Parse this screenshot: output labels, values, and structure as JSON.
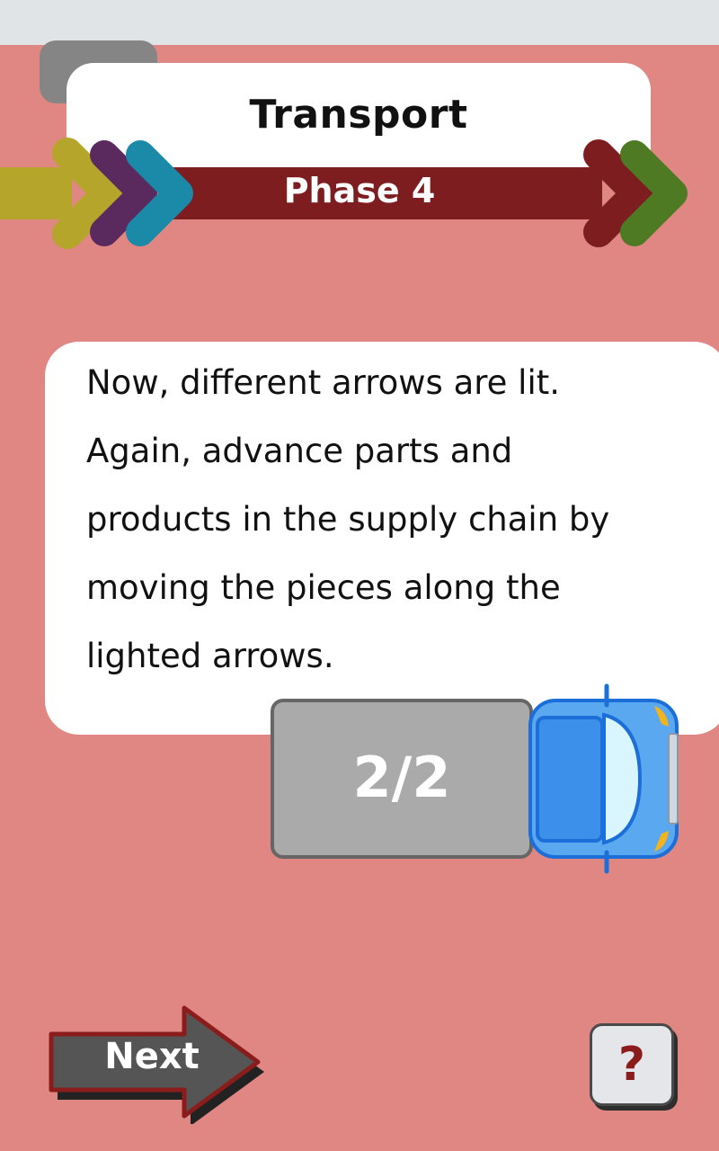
{
  "header": {
    "title": "Transport",
    "phase_label": "Phase 4"
  },
  "instruction": {
    "lines": [
      "Now, different arrows are lit.",
      "Again, advance parts and",
      "products in the supply chain by",
      "moving the pieces along the",
      "lighted arrows."
    ]
  },
  "truck": {
    "counter": "2/2"
  },
  "footer": {
    "next_label": "Next",
    "help_label": "?"
  },
  "colors": {
    "background": "#e08683",
    "arrow_olive": "#b5a52a",
    "arrow_purple": "#5a2a5e",
    "arrow_teal": "#1a8aa8",
    "arrow_maroon": "#7d1d20",
    "arrow_green": "#4e7a24",
    "truck_blue": "#5aa8f0"
  }
}
